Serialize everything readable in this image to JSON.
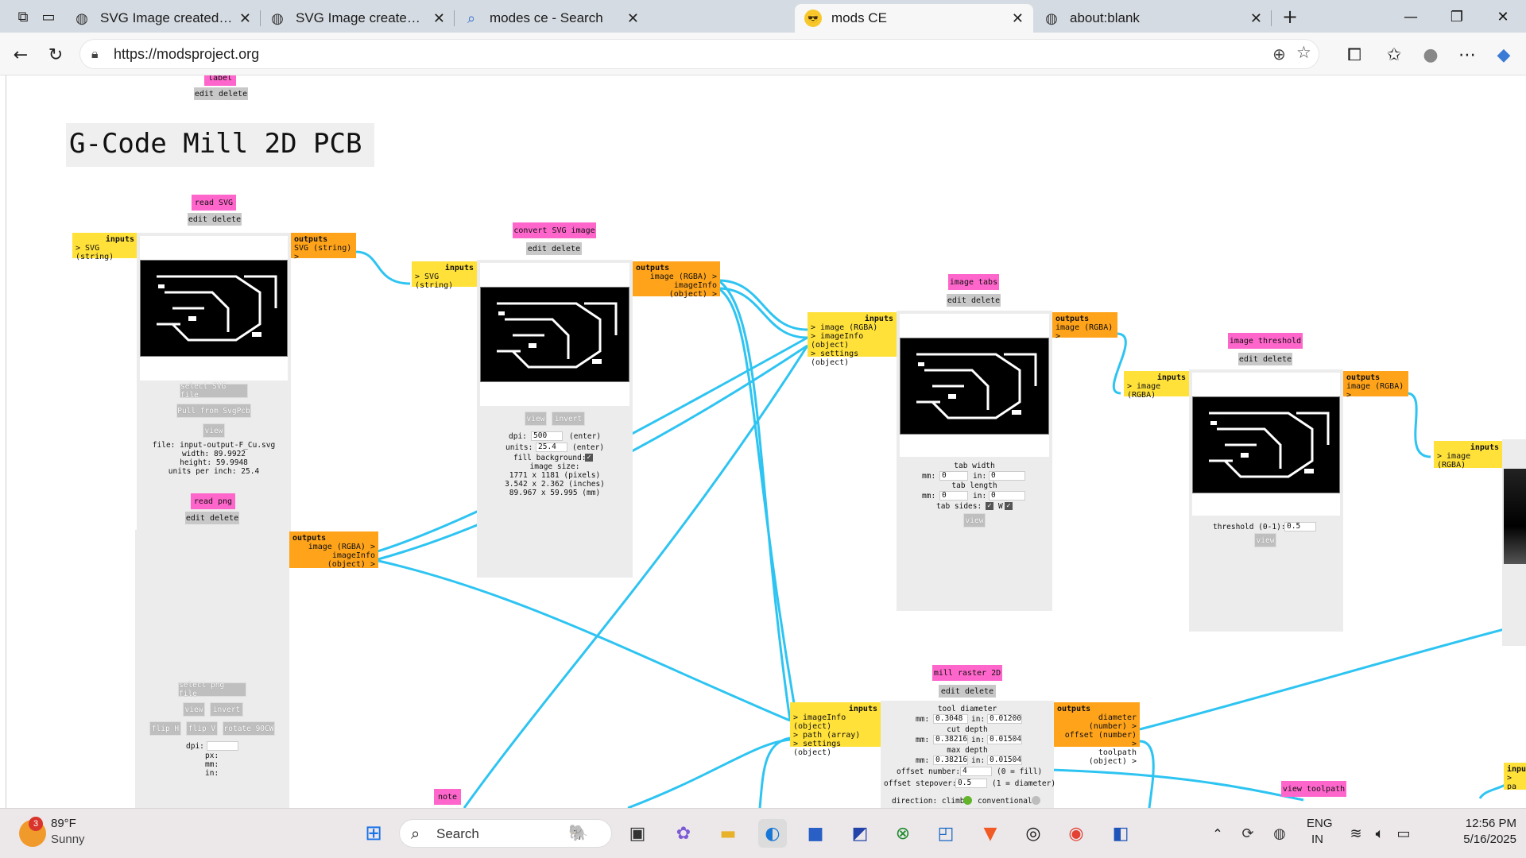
{
  "browser": {
    "tabs": [
      {
        "title": "SVG Image created as input-outp",
        "icon": "globe-icon"
      },
      {
        "title": "SVG Image created as input-outp",
        "icon": "globe-icon"
      },
      {
        "title": "modes ce - Search",
        "icon": "search-icon"
      },
      {
        "title": "mods CE",
        "icon": "sunglasses-emoji-icon"
      },
      {
        "title": "about:blank",
        "icon": "globe-icon"
      }
    ],
    "url": "https://modsproject.org"
  },
  "page": {
    "title": "G-Code Mill 2D PCB",
    "label_module": {
      "name": "label",
      "actions": "edit delete"
    }
  },
  "modules": {
    "read_svg": {
      "name": "read SVG",
      "actions": "edit delete",
      "inputs_label": "inputs",
      "inputs": [
        "> SVG (string)"
      ],
      "outputs_label": "outputs",
      "outputs": [
        "SVG (string) >"
      ],
      "buttons": [
        "select SVG file",
        "Pull from SvgPcb",
        "view"
      ],
      "info": [
        "file: input-output-F_Cu.svg",
        "width: 89.9922",
        "height: 59.9948",
        "units per inch: 25.4"
      ]
    },
    "convert_svg": {
      "name": "convert SVG image",
      "actions": "edit delete",
      "inputs_label": "inputs",
      "inputs": [
        "> SVG (string)"
      ],
      "outputs_label": "outputs",
      "outputs": [
        "image (RGBA) >",
        "imageInfo (object) >"
      ],
      "buttons": [
        "view",
        "invert"
      ],
      "dpi_label": "dpi:",
      "dpi": "500",
      "units_label": "units:",
      "units": "25.4",
      "enter": "(enter)",
      "fill_label": "fill background:",
      "info": [
        "image size:",
        "1771 x 1181 (pixels)",
        "3.542 x 2.362 (inches)",
        "89.967 x 59.995 (mm)"
      ]
    },
    "read_png": {
      "name": "read png",
      "actions": "edit delete",
      "outputs_label": "outputs",
      "outputs": [
        "image (RGBA) >",
        "imageInfo (object) >"
      ],
      "buttons": [
        "select png file",
        "view",
        "invert",
        "flip H",
        "flip V",
        "rotate 90CW"
      ],
      "fields": [
        "dpi:",
        "px:",
        "mm:",
        "in:"
      ]
    },
    "image_tabs": {
      "name": "image tabs",
      "actions": "edit delete",
      "inputs_label": "inputs",
      "inputs": [
        "> image (RGBA)",
        "> imageInfo (object)",
        "> settings (object)"
      ],
      "outputs_label": "outputs",
      "outputs": [
        "image (RGBA) >"
      ],
      "tab_width": "tab width",
      "tab_length": "tab length",
      "tab_sides": "tab sides: E",
      "tab_sides_w": "W",
      "mm": "mm:",
      "in": "in:",
      "zero": "0",
      "view": "view"
    },
    "image_threshold": {
      "name": "image threshold",
      "actions": "edit delete",
      "inputs_label": "inputs",
      "inputs": [
        "> image (RGBA)"
      ],
      "outputs_label": "outputs",
      "outputs": [
        "image (RGBA) >"
      ],
      "threshold_label": "threshold (0-1):",
      "threshold": "0.5",
      "view": "view"
    },
    "right_inputs": {
      "inputs_label": "inputs",
      "inputs": [
        "> image (RGBA)"
      ]
    },
    "mill_raster": {
      "name": "mill raster 2D",
      "actions": "edit delete",
      "inputs_label": "inputs",
      "inputs": [
        "> imageInfo (object)",
        "> path (array)",
        "> settings (object)"
      ],
      "outputs_label": "outputs",
      "outputs": [
        "diameter (number) >",
        "offset (number) >",
        "toolpath (object) >"
      ],
      "tool_diameter": "tool diameter",
      "cut_depth": "cut depth",
      "max_depth": "max depth",
      "mm": "mm:",
      "in": "in:",
      "td_mm": "0.3048",
      "td_in": "0.01200",
      "cd_mm": "0.38216",
      "cd_in": "0.01504",
      "md_mm": "0.38216",
      "md_in": "0.01504",
      "offset_number_label": "offset number:",
      "offset_number": "4",
      "offset_number_hint": "(0 = fill)",
      "stepover_label": "offset stepover:",
      "stepover": "0.5",
      "stepover_hint": "(1 = diameter)",
      "direction_label": "direction: climb",
      "conventional": "conventional"
    },
    "note": {
      "name": "note"
    },
    "view_toolpath": {
      "name": "view toolpath"
    },
    "right_bottom": {
      "inputs_label": "inpu",
      "inputs": [
        "> pa"
      ]
    }
  },
  "taskbar": {
    "weather": {
      "temp": "89°F",
      "condition": "Sunny",
      "badge": "3"
    },
    "search_placeholder": "Search",
    "lang": "ENG",
    "region": "IN",
    "time": "12:56 PM",
    "date": "5/16/2025"
  },
  "colors": {
    "module_label": "#ff66cc",
    "inputs": "#ffe13a",
    "outputs": "#ffa31a",
    "wire": "#2ec4f2"
  }
}
